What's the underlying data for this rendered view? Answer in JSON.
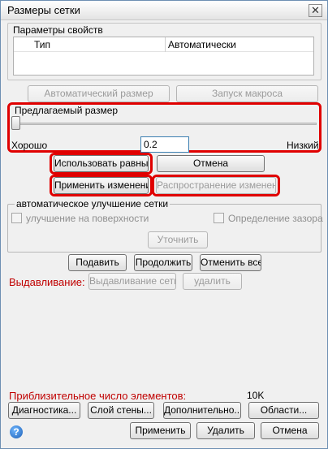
{
  "window": {
    "title": "Размеры сетки",
    "close_glyph": "✕"
  },
  "properties": {
    "label": "Параметры свойств",
    "row": {
      "name": "Тип",
      "value": "Автоматически"
    }
  },
  "auto_size_button": "Автоматический размер",
  "run_macro_button": "Запуск макроса",
  "suggested_size": {
    "label": "Предлагаемый размер",
    "left_label": "Хорошо",
    "right_label": "Низкий",
    "value": "0.2",
    "slider_level": 0
  },
  "use_equal_button": "Использовать равные",
  "cancel_button": "Отмена",
  "apply_changes_button": "Применить изменения",
  "propagate_button": "Распространение изменений",
  "auto_refine": {
    "label": "автоматическое улучшение сетки",
    "surface_label": "улучшение на поверхности",
    "gap_label": "Определение зазора",
    "refine_button": "Уточнить"
  },
  "suppress_button": "Подавить",
  "continue_button": "Продолжить",
  "cancel_all_button": "Отменить все",
  "extrusion": {
    "label": "Выдавливание:",
    "mesh_button": "Выдавливание сети",
    "delete_button": "удалить"
  },
  "element_count": {
    "label": "Приблизительное число элементов:",
    "value": "10K"
  },
  "diagnostics_button": "Диагностика...",
  "wall_layer_button": "Слой стены...",
  "advanced_button": "Дополнительно...",
  "regions_button": "Области...",
  "apply_button": "Применить",
  "delete_button": "Удалить",
  "footer_cancel_button": "Отмена",
  "help_icon_glyph": "?"
}
